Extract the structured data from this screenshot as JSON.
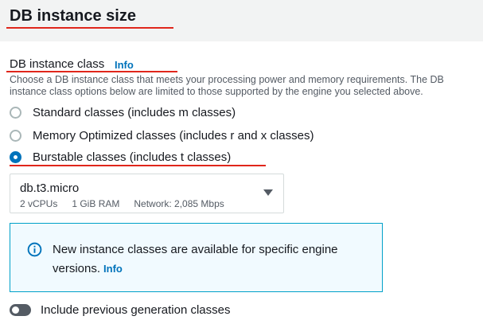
{
  "section": {
    "title": "DB instance size"
  },
  "instance_class": {
    "label": "DB instance class",
    "info_label": "Info",
    "description": "Choose a DB instance class that meets your processing power and memory requirements. The DB instance class options below are limited to those supported by the engine you selected above.",
    "options": [
      {
        "label": "Standard classes (includes m classes)",
        "checked": false
      },
      {
        "label": "Memory Optimized classes (includes r and x classes)",
        "checked": false
      },
      {
        "label": "Burstable classes (includes t classes)",
        "checked": true
      }
    ]
  },
  "select": {
    "value": "db.t3.micro",
    "vcpus": "2 vCPUs",
    "ram": "1 GiB RAM",
    "network": "Network: 2,085 Mbps"
  },
  "alert": {
    "text": "New instance classes are available for specific engine versions.",
    "info_label": "Info"
  },
  "toggle": {
    "label": "Include previous generation classes",
    "on": false
  },
  "colors": {
    "accent": "#0073bb",
    "annotation": "#e0261b",
    "alert_border": "#00a1c9",
    "alert_bg": "#f1faff"
  }
}
